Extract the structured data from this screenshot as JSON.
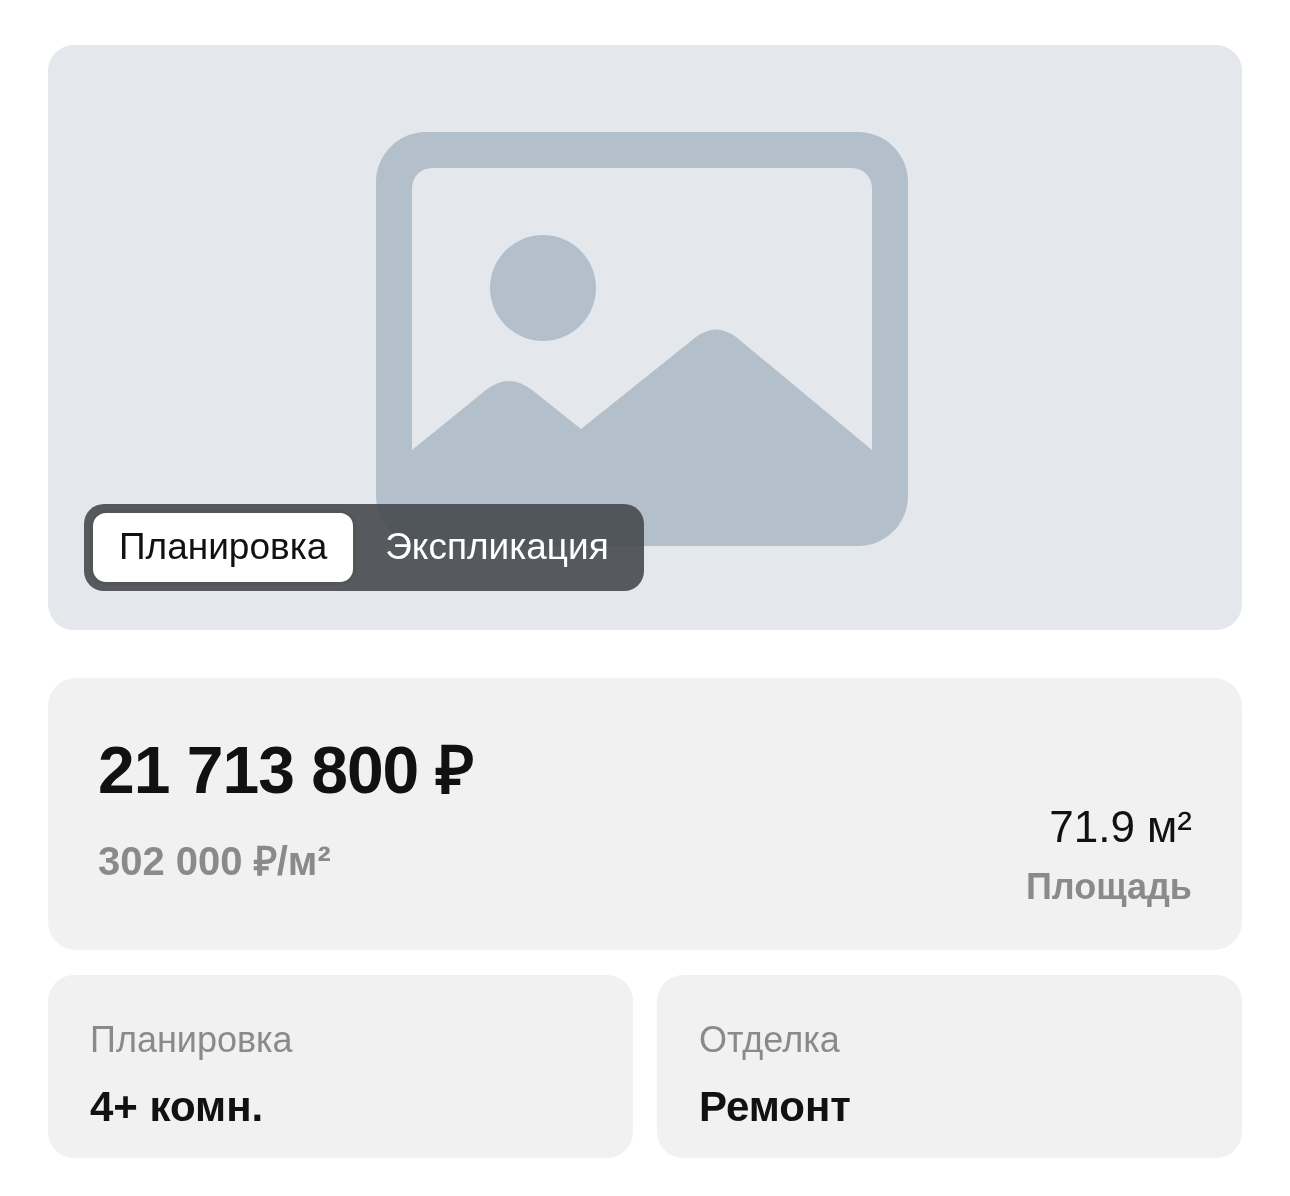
{
  "gallery": {
    "tabs": [
      {
        "label": "Планировка",
        "selected": true
      },
      {
        "label": "Экспликация",
        "selected": false
      }
    ]
  },
  "price": {
    "total": "21 713 800 ₽",
    "per_meter": "302 000 ₽/м²",
    "area": "71.9 м²",
    "area_label": "Площадь"
  },
  "features": [
    {
      "label": "Планировка",
      "value": "4+ комн."
    },
    {
      "label": "Отделка",
      "value": "Ремонт"
    }
  ]
}
